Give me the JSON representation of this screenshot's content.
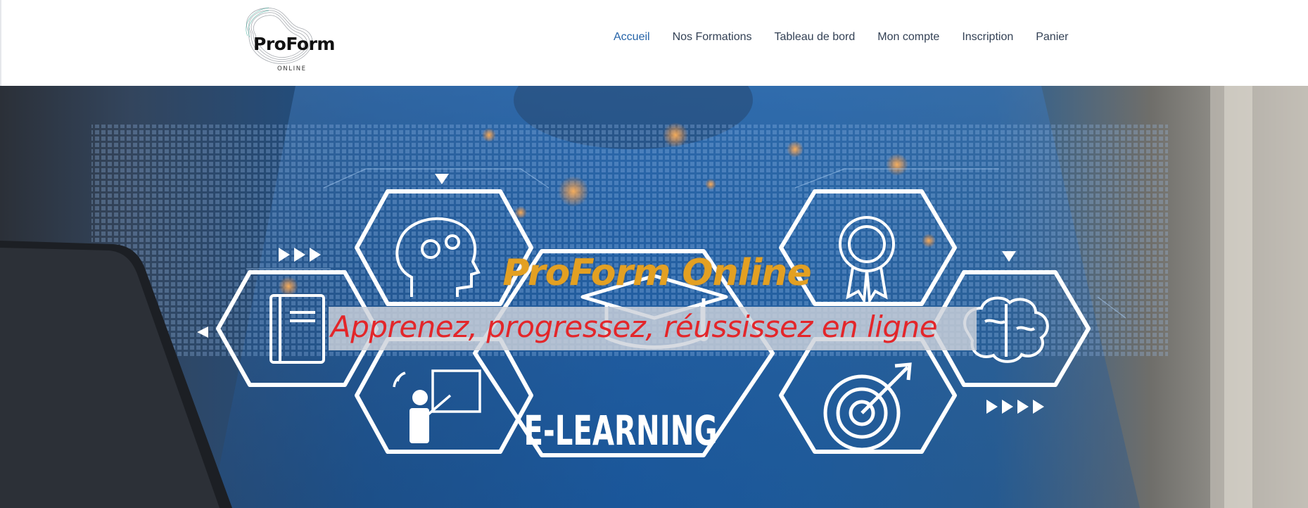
{
  "brand": {
    "name": "ProForm",
    "subtitle": "ONLINE"
  },
  "nav": {
    "items": [
      {
        "label": "Accueil",
        "active": true
      },
      {
        "label": "Nos Formations",
        "active": false
      },
      {
        "label": "Tableau de bord",
        "active": false
      },
      {
        "label": "Mon compte",
        "active": false
      },
      {
        "label": "Inscription",
        "active": false
      },
      {
        "label": "Panier",
        "active": false
      }
    ]
  },
  "hero": {
    "title": "ProForm Online",
    "tagline": "Apprenez, progressez, réussissez en ligne",
    "image_text": "E-LEARNING"
  },
  "colors": {
    "nav_active": "#2563a8",
    "nav_text": "#334155",
    "hero_title": "#e3a022",
    "hero_tagline": "#e3262a"
  }
}
